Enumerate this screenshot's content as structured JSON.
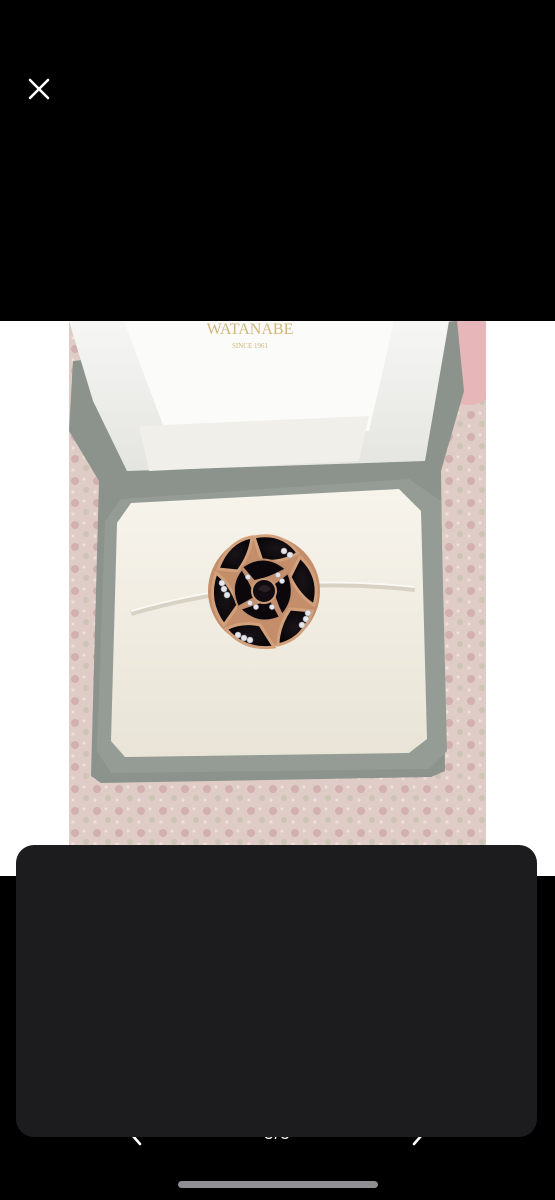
{
  "viewer": {
    "close_icon": "close-icon",
    "pager": {
      "current": 5,
      "total": 5,
      "label": "5/5",
      "prev_icon": "chevron-left-icon",
      "next_icon": "chevron-right-icon"
    }
  },
  "photo": {
    "box_brand": "WATANABE",
    "box_since": "SINCE 1961"
  },
  "colors": {
    "background": "#000000",
    "sheet": "#1c1c1e",
    "home_indicator": "#8e8e93"
  }
}
